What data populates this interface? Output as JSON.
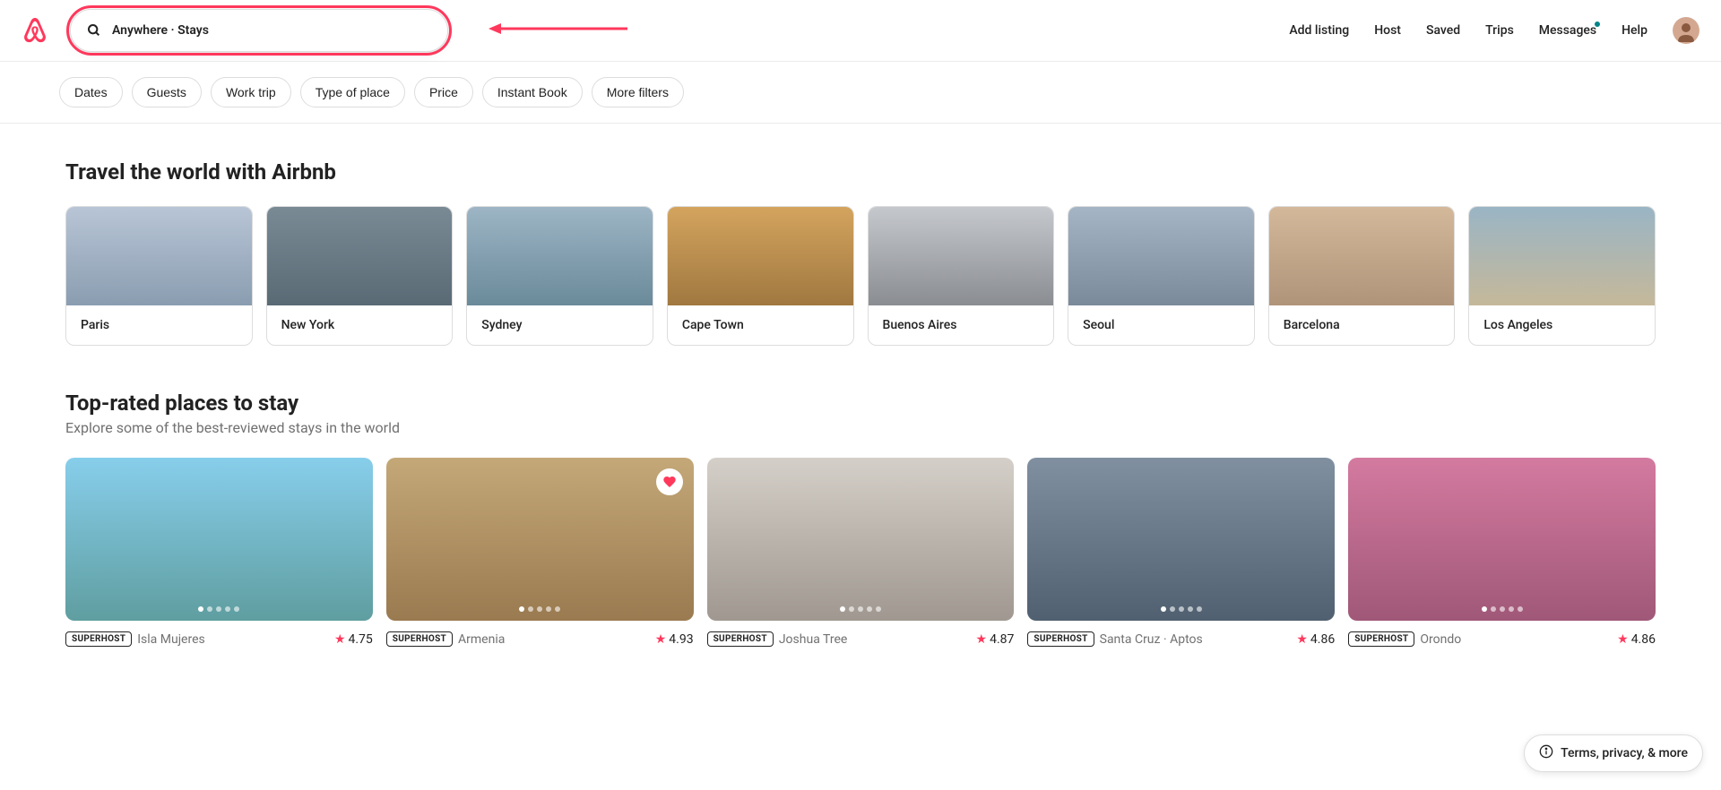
{
  "header": {
    "search_text": "Anywhere · Stays",
    "nav": {
      "add_listing": "Add listing",
      "host": "Host",
      "saved": "Saved",
      "trips": "Trips",
      "messages": "Messages",
      "help": "Help"
    }
  },
  "filters": [
    "Dates",
    "Guests",
    "Work trip",
    "Type of place",
    "Price",
    "Instant Book",
    "More filters"
  ],
  "sections": {
    "travel": {
      "title": "Travel the world with Airbnb",
      "destinations": [
        "Paris",
        "New York",
        "Sydney",
        "Cape Town",
        "Buenos Aires",
        "Seoul",
        "Barcelona",
        "Los Angeles"
      ]
    },
    "top_rated": {
      "title": "Top-rated places to stay",
      "subtitle": "Explore some of the best-reviewed stays in the world",
      "listings": [
        {
          "badge": "SUPERHOST",
          "location": "Isla Mujeres",
          "rating": "4.75",
          "saved": false
        },
        {
          "badge": "SUPERHOST",
          "location": "Armenia",
          "rating": "4.93",
          "saved": true
        },
        {
          "badge": "SUPERHOST",
          "location": "Joshua Tree",
          "rating": "4.87",
          "saved": false
        },
        {
          "badge": "SUPERHOST",
          "location": "Santa Cruz · Aptos",
          "rating": "4.86",
          "saved": false
        },
        {
          "badge": "SUPERHOST",
          "location": "Orondo",
          "rating": "4.86",
          "saved": false
        }
      ]
    }
  },
  "terms_pill": "Terms, privacy, & more",
  "colors": {
    "brand": "#FF385C",
    "text": "#222222",
    "muted": "#717171"
  }
}
